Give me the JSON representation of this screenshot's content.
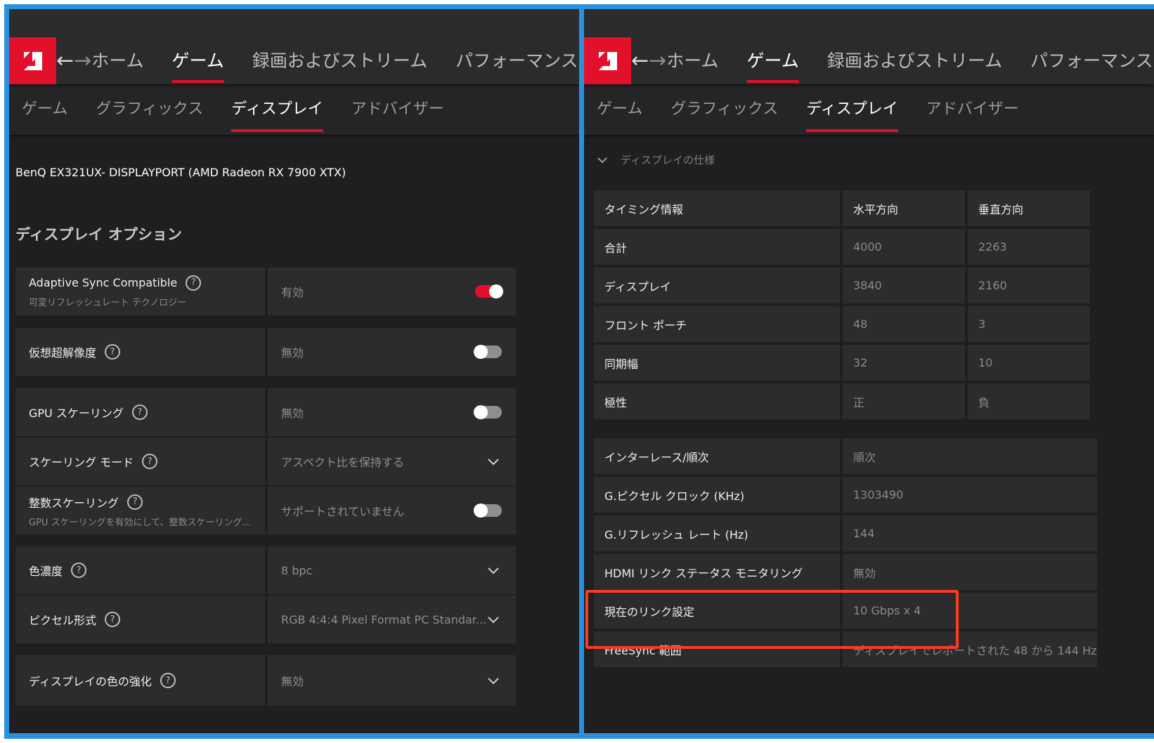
{
  "nav": {
    "back": "←",
    "forward": "→",
    "items": [
      "ホーム",
      "ゲーム",
      "録画およびストリーム",
      "パフォーマンス"
    ],
    "active": "ゲーム"
  },
  "subnav": {
    "items": [
      "ゲーム",
      "グラフィックス",
      "ディスプレイ",
      "アドバイザー"
    ],
    "active": "ディスプレイ"
  },
  "left": {
    "monitor": "BenQ EX321UX- DISPLAYPORT (AMD Radeon RX 7900 XTX)",
    "section_title": "ディスプレイ オプション",
    "options": [
      {
        "label": "Adaptive Sync Compatible",
        "sub": "可変リフレッシュレート テクノロジー",
        "value": "有効",
        "control": "toggle-on"
      },
      {
        "label": "仮想超解像度",
        "sub": "",
        "value": "無効",
        "control": "toggle-off"
      },
      {
        "label": "GPU スケーリング",
        "sub": "",
        "value": "無効",
        "control": "toggle-off"
      },
      {
        "label": "スケーリング モード",
        "sub": "",
        "value": "アスペクト比を保持する",
        "control": "dropdown"
      },
      {
        "label": "整数スケーリング",
        "sub": "GPU スケーリングを有効にして、整数スケーリングを可能...",
        "value": "サポートされていません",
        "control": "toggle-off"
      },
      {
        "label": "色濃度",
        "sub": "",
        "value": "8 bpc",
        "control": "dropdown"
      },
      {
        "label": "ピクセル形式",
        "sub": "",
        "value": "RGB 4:4:4 Pixel Format PC Standar...",
        "control": "dropdown"
      },
      {
        "label": "ディスプレイの色の強化",
        "sub": "",
        "value": "無効",
        "control": "dropdown"
      }
    ]
  },
  "right": {
    "spec_header": "ディスプレイの仕様",
    "timing": {
      "headers": [
        "タイミング情報",
        "水平方向",
        "垂直方向"
      ],
      "rows": [
        [
          "合計",
          "4000",
          "2263"
        ],
        [
          "ディスプレイ",
          "3840",
          "2160"
        ],
        [
          "フロント ポーチ",
          "48",
          "3"
        ],
        [
          "同期幅",
          "32",
          "10"
        ],
        [
          "極性",
          "正",
          "負"
        ]
      ]
    },
    "info": [
      [
        "インターレース/順次",
        "順次"
      ],
      [
        "G.ピクセル クロック (KHz)",
        "1303490"
      ],
      [
        "G.リフレッシュ レート (Hz)",
        "144"
      ],
      [
        "HDMI リンク ステータス モニタリング",
        "無効"
      ],
      [
        "現在のリンク設定",
        "10 Gbps x 4"
      ],
      [
        "FreeSync 範囲",
        "ディスプレイでレポートされた 48 から 144 Hz"
      ]
    ]
  },
  "colors": {
    "accent": "#e3102b",
    "highlight": "#ff3b1f",
    "background": "#1f1f21",
    "panel": "#2c2c2e",
    "frame": "#2b91dd"
  }
}
